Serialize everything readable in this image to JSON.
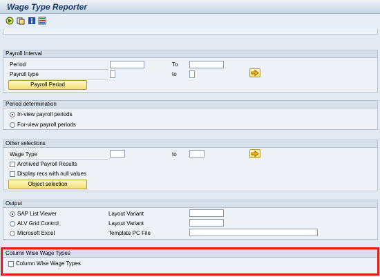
{
  "window": {
    "title": "Wage Type Reporter"
  },
  "toolbar": {
    "icons": [
      "execute-icon",
      "variant-icon",
      "info-icon",
      "selection-options-icon"
    ]
  },
  "payroll_interval": {
    "header": "Payroll Interval",
    "period_label": "Period",
    "period_value": "",
    "to_label": "To",
    "to_value": "",
    "payroll_type_label": "Payroll type",
    "payroll_type_value": "",
    "payroll_type_to_label": "to",
    "payroll_type_to_value": "",
    "payroll_period_button": "Payroll Period"
  },
  "period_determination": {
    "header": "Period determination",
    "options": [
      "In-view payroll periods",
      "For-view payroll periods"
    ],
    "selected": "In-view payroll periods"
  },
  "other_selections": {
    "header": "Other selections",
    "wage_type_label": "Wage Type",
    "wage_type_value": "",
    "wage_type_to_label": "to",
    "wage_type_to_value": "",
    "archived_label": "Archived Payroll Results",
    "archived_checked": false,
    "null_values_label": "Display recs with null values",
    "null_values_checked": false,
    "object_selection_button": "Object selection"
  },
  "output": {
    "header": "Output",
    "options": [
      "SAP List Viewer",
      "ALV Grid Control",
      "Microsoft Excel"
    ],
    "selected": "SAP List Viewer",
    "layout_variant_label_1": "Layout Variant",
    "layout_variant_label_2": "Layout Variant",
    "template_label": "Template PC File",
    "layout_variant_value_1": "",
    "layout_variant_value_2": "",
    "template_value": ""
  },
  "column_wise": {
    "header": "Column Wise Wage Types",
    "checkbox_label": "Column Wise Wage Types",
    "checked": false
  },
  "colors": {
    "highlight": "#e0201a",
    "button_yellow": "#f3df72",
    "title_blue": "#1b3c6b"
  }
}
